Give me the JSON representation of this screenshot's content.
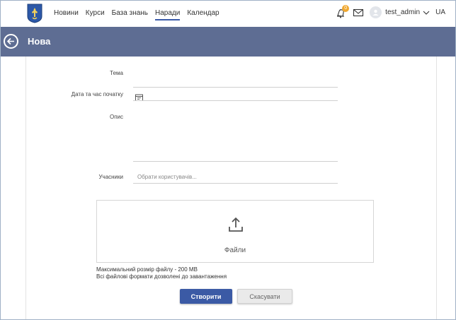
{
  "nav": {
    "items": [
      {
        "label": "Новини"
      },
      {
        "label": "Курси"
      },
      {
        "label": "База знань"
      },
      {
        "label": "Наради",
        "active": true
      },
      {
        "label": "Календар"
      }
    ]
  },
  "notifications": {
    "count": "0"
  },
  "user": {
    "name": "test_admin",
    "language": "UA"
  },
  "header": {
    "title": "Нова"
  },
  "form": {
    "topic_label": "Тема",
    "start_label": "Дата та час початку",
    "description_label": "Опис",
    "participants_label": "Учасники",
    "participants_placeholder": "Обрати користувачів..."
  },
  "upload": {
    "label": "Файли",
    "max_size": "Максимальний розмір файлу - 200 MB",
    "formats": "Всі файлові формати дозволені до завантаження"
  },
  "actions": {
    "create_label": "Створити",
    "cancel_label": "Скасувати"
  },
  "colors": {
    "header_bg": "#5e6d93",
    "primary": "#3b5aa5",
    "badge": "#f0a830"
  }
}
